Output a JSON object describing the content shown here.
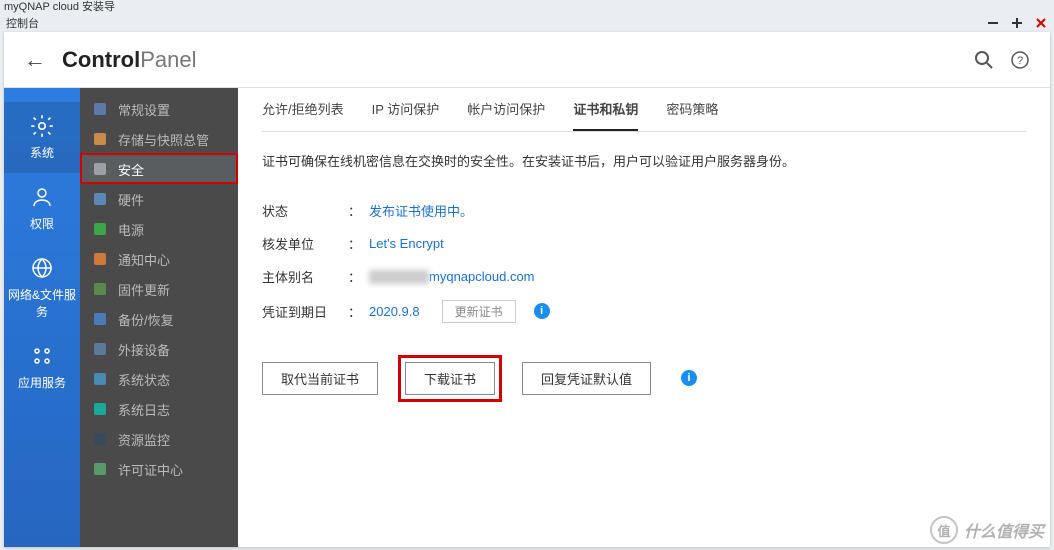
{
  "topmost_text": "myQNAP cloud 安装导",
  "titlebar": {
    "title": "控制台"
  },
  "app_title": {
    "bold": "Control",
    "light": "Panel"
  },
  "rail": [
    {
      "label": "系统",
      "icon": "gear-icon",
      "active": true
    },
    {
      "label": "权限",
      "icon": "user-icon",
      "active": false
    },
    {
      "label": "网络&文件服务",
      "icon": "globe-icon",
      "active": false
    },
    {
      "label": "应用服务",
      "icon": "apps-icon",
      "active": false
    }
  ],
  "sidebar": [
    {
      "label": "常规设置",
      "icon": "clipboard-icon",
      "color": "#5b7aa8"
    },
    {
      "label": "存储与快照总管",
      "icon": "disk-icon",
      "color": "#c98b4a"
    },
    {
      "label": "安全",
      "icon": "lock-icon",
      "color": "#9aa0a6",
      "selected": true,
      "highlighted": true
    },
    {
      "label": "硬件",
      "icon": "chip-icon",
      "color": "#5a88b8"
    },
    {
      "label": "电源",
      "icon": "bulb-icon",
      "color": "#3aa84a"
    },
    {
      "label": "通知中心",
      "icon": "bell-icon",
      "color": "#d07a3a"
    },
    {
      "label": "固件更新",
      "icon": "refresh-icon",
      "color": "#5a8a4a"
    },
    {
      "label": "备份/恢复",
      "icon": "backup-icon",
      "color": "#4a7ab8"
    },
    {
      "label": "外接设备",
      "icon": "usb-icon",
      "color": "#5a7a9a"
    },
    {
      "label": "系统状态",
      "icon": "monitor-icon",
      "color": "#4a8ab0"
    },
    {
      "label": "系统日志",
      "icon": "log-icon",
      "color": "#1aa89a"
    },
    {
      "label": "资源监控",
      "icon": "pulse-icon",
      "color": "#3a4a5a"
    },
    {
      "label": "许可证中心",
      "icon": "license-icon",
      "color": "#5a9a6a"
    }
  ],
  "tabs": [
    {
      "label": "允许/拒绝列表",
      "active": false
    },
    {
      "label": "IP 访问保护",
      "active": false
    },
    {
      "label": "帐户访问保护",
      "active": false
    },
    {
      "label": "证书和私钥",
      "active": true
    },
    {
      "label": "密码策略",
      "active": false
    }
  ],
  "description": "证书可确保在线机密信息在交换时的安全性。在安装证书后，用户可以验证用户服务器身份。",
  "fields": {
    "status": {
      "label": "状态",
      "value": "发布证书使用中。"
    },
    "issuer": {
      "label": "核发单位",
      "value": "Let's Encrypt"
    },
    "san": {
      "label": "主体别名",
      "value_suffix": "myqnapcloud.com"
    },
    "expiry": {
      "label": "凭证到期日",
      "value": "2020.9.8",
      "renew_btn": "更新证书"
    }
  },
  "actions": {
    "replace": "取代当前证书",
    "download": "下载证书",
    "restore": "回复凭证默认值"
  },
  "watermark": {
    "badge": "值",
    "text": "什么值得买"
  }
}
